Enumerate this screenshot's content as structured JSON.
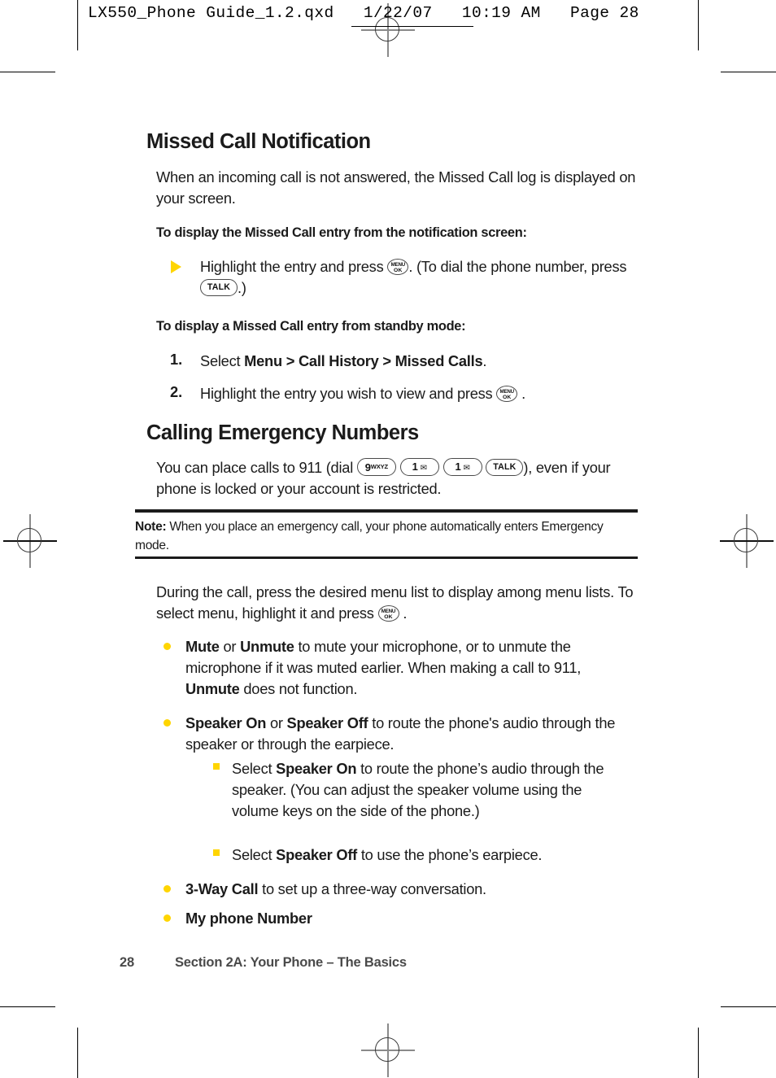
{
  "slug": {
    "text": "LX550_Phone Guide_1.2.qxd   1/22/07   10:19 AM   Page 28"
  },
  "colors": {
    "bullet_yellow": "#FFD500",
    "text": "#1b1b1b",
    "footer_grey": "#4a4a4a"
  },
  "keys": {
    "menu_line1": "MENU",
    "menu_line2": "OK",
    "talk": "TALK",
    "nine_digit": "9",
    "nine_letters": "WXYZ",
    "one_digit": "1",
    "one_symbol": "✉"
  },
  "sections": [
    {
      "heading": "Missed Call Notification",
      "intro": "When an incoming call is not answered, the Missed Call log is displayed on your screen.",
      "subhead1": "To display the Missed Call entry from the notification screen:",
      "tri_item_a": "Highlight the entry and press",
      "tri_item_b": ". (To dial the phone number, press",
      "tri_item_c": ".)",
      "subhead2": "To display a Missed Call entry from standby mode:",
      "steps": [
        {
          "number": "1.",
          "lead": "Select ",
          "bold": "Menu > Call History > Missed Calls",
          "tail": "."
        },
        {
          "number": "2.",
          "lead": "Highlight the entry you wish to view and press",
          "bold": "",
          "tail": "."
        }
      ]
    },
    {
      "heading": "Calling Emergency Numbers",
      "lead": "You can place calls to 911 (dial",
      "tail": "), even if your phone is locked or your account is restricted."
    }
  ],
  "note": {
    "label": "Note:",
    "body": " When you place an emergency call, your phone automatically enters Emergency mode."
  },
  "during_call": {
    "para_a": "During the call, press the desired menu list to display among menu lists. To select menu, highlight it and press",
    "para_b": ".",
    "bullets": [
      {
        "b1": "Mute",
        "mid1": " or ",
        "b2": "Unmute",
        "mid2": " to mute your microphone, or to unmute the microphone if it was muted earlier. When making a call to 911, ",
        "b3": "Unmute",
        "tail": " does not function."
      },
      {
        "b1": "Speaker On",
        "mid1": " or ",
        "b2": "Speaker Off",
        "mid2": " to route the phone's audio through the speaker or through the earpiece.",
        "b3": "",
        "tail": ""
      },
      {
        "b1": "3-Way Call",
        "mid1": "",
        "b2": "",
        "mid2": " to set up a three-way conversation.",
        "b3": "",
        "tail": ""
      },
      {
        "b1": "My phone Number",
        "mid1": "",
        "b2": "",
        "mid2": "",
        "b3": "",
        "tail": ""
      }
    ],
    "sub_bullets": [
      {
        "lead": "Select ",
        "bold": "Speaker On",
        "tail": " to route the phone’s audio through the speaker. (You can adjust the speaker volume using the volume keys on the side of the phone.)"
      },
      {
        "lead": "Select ",
        "bold": "Speaker Off",
        "tail": " to use the phone’s earpiece."
      }
    ]
  },
  "footer": {
    "page_number": "28",
    "section_label": "Section 2A: Your Phone – The Basics"
  }
}
